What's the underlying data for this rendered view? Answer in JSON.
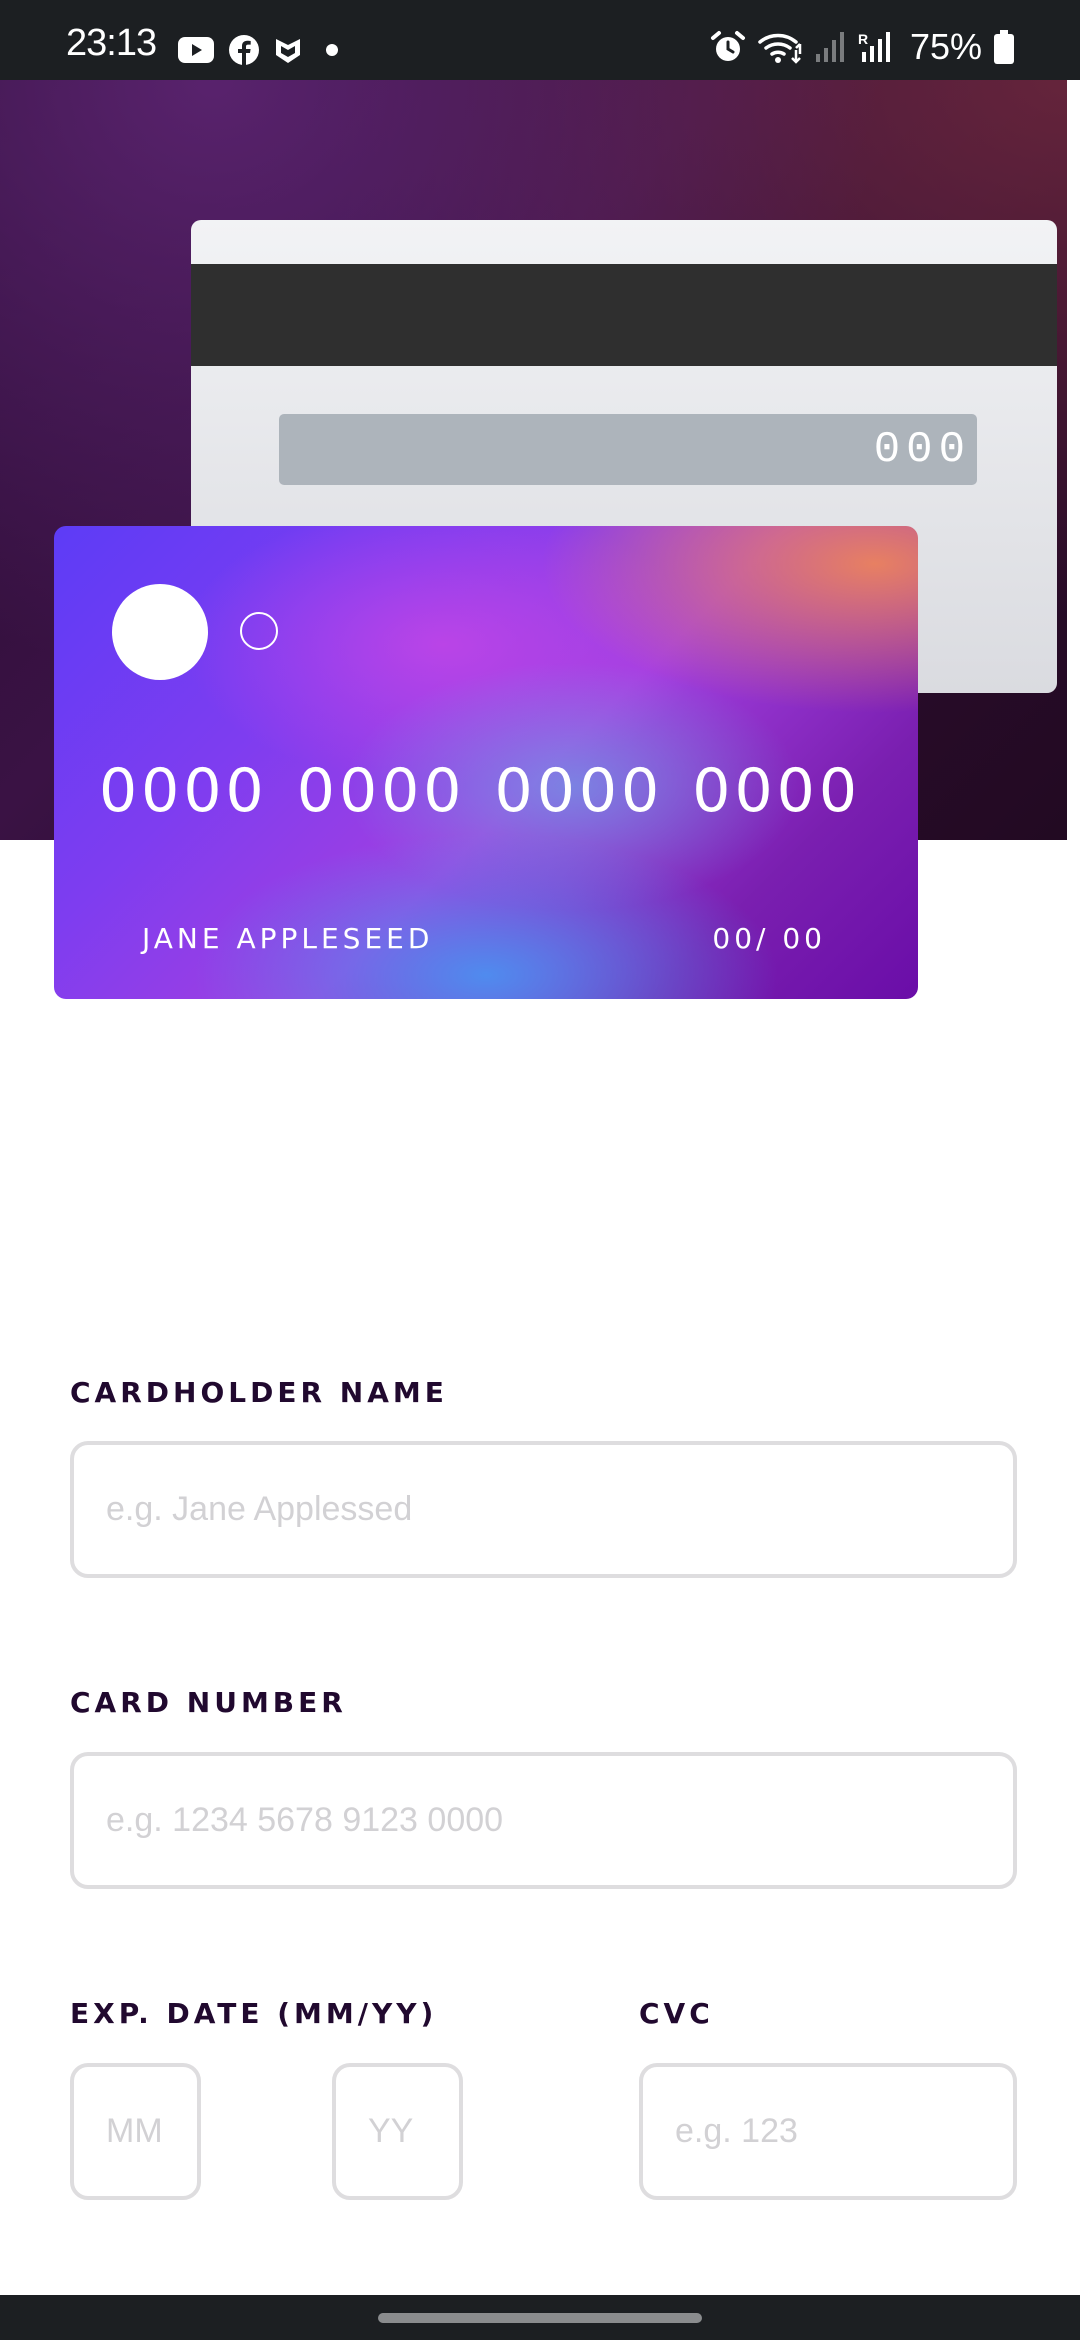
{
  "status_bar": {
    "time": "23:13",
    "left_icons": [
      "youtube-icon",
      "facebook-icon",
      "mcafee-icon",
      "dot-icon"
    ],
    "right_icons": [
      "alarm-icon",
      "wifi-icon",
      "signal-icon",
      "signal-r-icon",
      "battery-icon"
    ],
    "battery": "75%"
  },
  "card_back": {
    "cvc": "000"
  },
  "card_front": {
    "number": "0000 0000 0000 0000",
    "name": "JANE APPLESEED",
    "expiry": "00/ 00"
  },
  "form": {
    "name_label": "CARDHOLDER NAME",
    "name_placeholder": "e.g. Jane Applessed",
    "number_label": "CARD NUMBER",
    "number_placeholder": "e.g. 1234 5678 9123 0000",
    "exp_label": "EXP. DATE (MM/YY)",
    "month_placeholder": "MM",
    "year_placeholder": "YY",
    "cvc_label": "CVC",
    "cvc_placeholder": "e.g. 123"
  },
  "colors": {
    "label": "#21092f",
    "input_border": "#dedddf",
    "placeholder": "#d2d1d4",
    "system_bar": "#1c1f22"
  }
}
